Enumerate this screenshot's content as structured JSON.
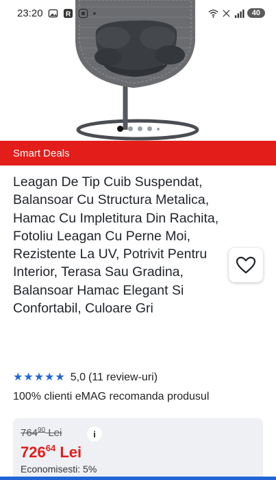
{
  "status_bar": {
    "time": "23:20",
    "dot": "•",
    "battery": "40"
  },
  "banner": {
    "label": "Smart Deals"
  },
  "product": {
    "title": "Leagan De Tip Cuib Suspendat, Balansoar Cu Structura Metalica, Hamac Cu Impletitura Din Rachita, Fotoliu Leagan Cu Perne Moi, Rezistente La UV, Potrivit Pentru Interior, Terasa Sau Gradina, Balansoar Hamac Elegant Si Confortabil, Culoare Gri",
    "rating": {
      "value": "5,0",
      "reviews": "(11 review-uri)",
      "stars": 5
    },
    "recommend_text": "100% clienti eMAG recomanda produsul",
    "price": {
      "old_whole": "764",
      "old_decimals": "90",
      "old_currency": "Lei",
      "new_whole": "726",
      "new_decimals": "64",
      "new_currency": "Lei",
      "savings": "Economisesti: 5%"
    }
  },
  "carousel": {
    "dots": 5,
    "active_index": 0
  },
  "colors": {
    "accent_red": "#e31d1a",
    "accent_blue": "#1f65d6"
  },
  "icons": {
    "favorite": "heart-icon",
    "info": "info-icon",
    "star": "star-icon"
  }
}
